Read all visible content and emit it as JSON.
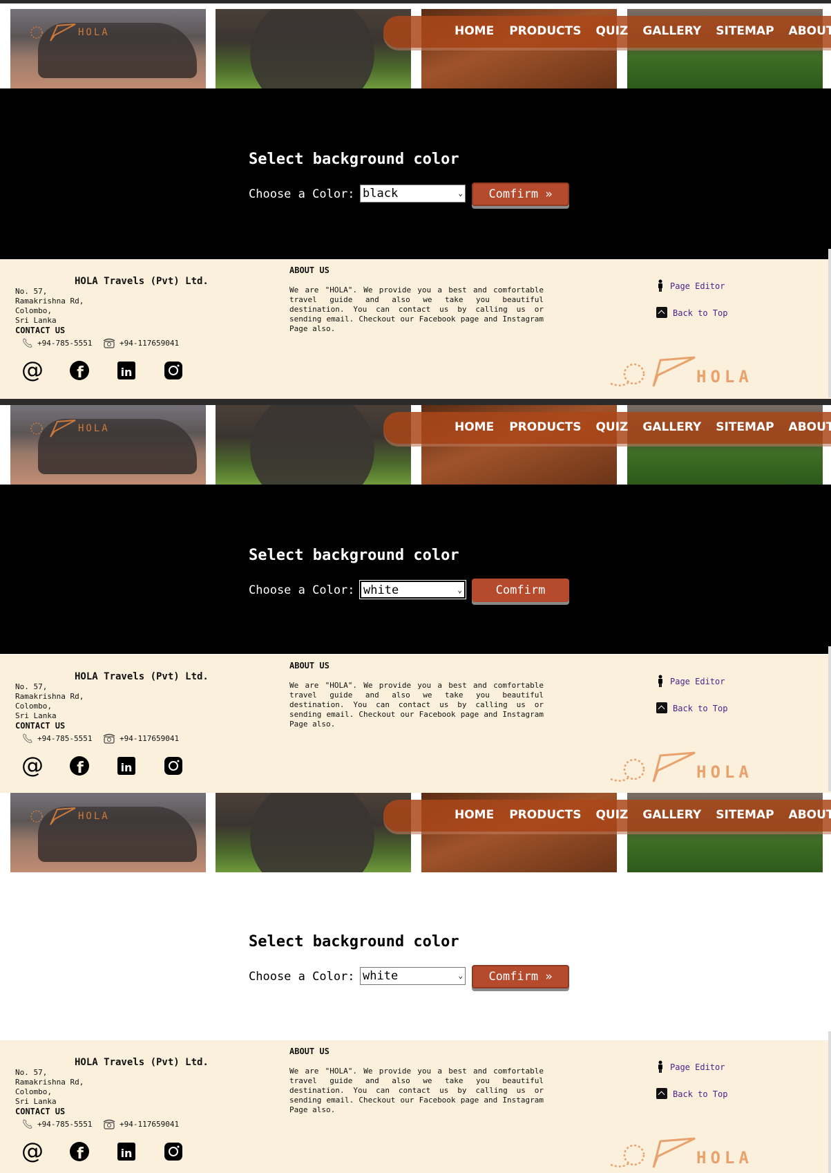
{
  "nav": {
    "items": [
      "HOME",
      "PRODUCTS",
      "QUIZ",
      "GALLERY",
      "SITEMAP",
      "ABOUT US"
    ]
  },
  "logo": {
    "text": "HOLA"
  },
  "colors": {
    "accent": "#b54a2d",
    "nav_background": "#aa4619",
    "footer_background": "#faf0dc",
    "link": "#4b1e8c"
  },
  "panels": [
    {
      "theme": "black",
      "title": "Select background color",
      "choose_label": "Choose a Color:",
      "select_value": "black",
      "confirm_label": "Comfirm »"
    },
    {
      "theme": "black",
      "title": "Select background color",
      "choose_label": "Choose a Color:",
      "select_value": "white",
      "confirm_label": "Comfirm"
    },
    {
      "theme": "white",
      "title": "Select background color",
      "choose_label": "Choose a Color:",
      "select_value": "white",
      "confirm_label": "Comfirm »"
    }
  ],
  "footer": {
    "company": "HOLA Travels (Pvt) Ltd.",
    "address": [
      "No. 57,",
      "Ramakrishna Rd,",
      "Colombo,",
      "Sri Lanka"
    ],
    "contact_title": "CONTACT US",
    "phone_mobile": "+94-785-5551",
    "phone_land": "+94-117659041",
    "about_title": "ABOUT US",
    "about_text": "We are \"HOLA\". We provide you a best and comfortable travel guide and also we take you beautiful destination. You can contact us by calling us or sending email. Checkout our Facebook page and Instagram Page also.",
    "page_editor": "Page Editor",
    "back_to_top": "Back to Top",
    "social_icons": [
      "email-icon",
      "facebook-icon",
      "linkedin-icon",
      "instagram-icon"
    ]
  }
}
